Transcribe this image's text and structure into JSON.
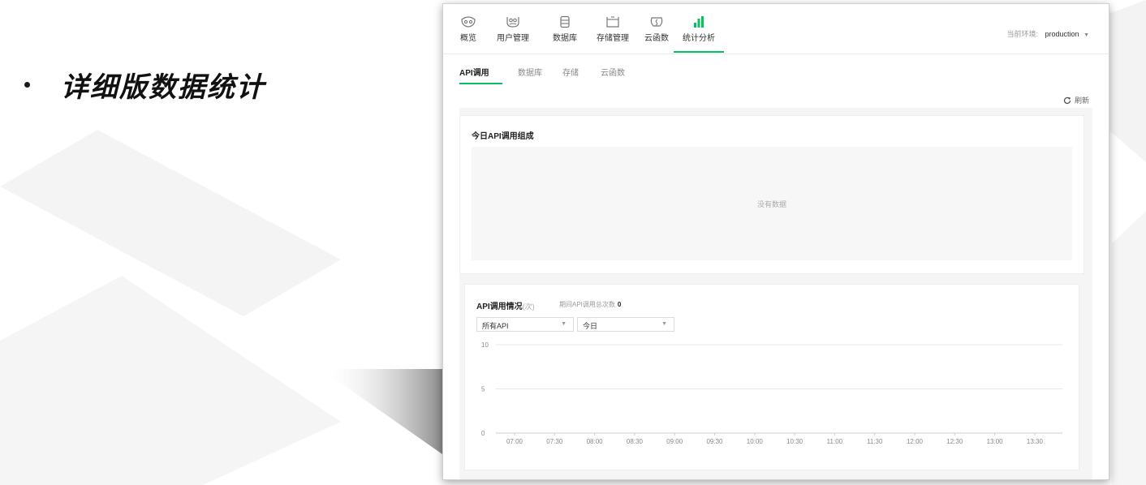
{
  "slide": {
    "bullet_text": "详细版数据统计"
  },
  "topnav": {
    "items": [
      {
        "label": "概览",
        "icon": "eye-mask-icon"
      },
      {
        "label": "用户管理",
        "icon": "users-icon"
      },
      {
        "label": "数据库",
        "icon": "database-icon"
      },
      {
        "label": "存储管理",
        "icon": "storage-icon"
      },
      {
        "label": "云函数",
        "icon": "cloud-function-icon"
      },
      {
        "label": "统计分析",
        "icon": "bar-chart-icon",
        "active": true
      }
    ],
    "env_label": "当前环境:",
    "env_value": "production"
  },
  "subtabs": [
    {
      "label": "API调用",
      "active": true
    },
    {
      "label": "数据库"
    },
    {
      "label": "存储"
    },
    {
      "label": "云函数"
    }
  ],
  "refresh_label": "刷新",
  "today_card": {
    "title": "今日API调用组成",
    "empty_text": "没有数据"
  },
  "usage_card": {
    "title": "API调用情况",
    "unit": "(次)",
    "total_label": "期间API调用总次数",
    "total_value": "0",
    "api_select": "所有API",
    "date_select": "今日"
  },
  "chart_data": {
    "type": "line",
    "x": [
      "07:00",
      "07:30",
      "08:00",
      "08:30",
      "09:00",
      "09:30",
      "10:00",
      "10:30",
      "11:00",
      "11:30",
      "12:00",
      "12:30",
      "13:00",
      "13:30"
    ],
    "series": [],
    "y_ticks": [
      "10",
      "5",
      "0"
    ],
    "ylim": [
      0,
      10
    ],
    "grid": true
  },
  "colors": {
    "accent": "#07c160"
  }
}
